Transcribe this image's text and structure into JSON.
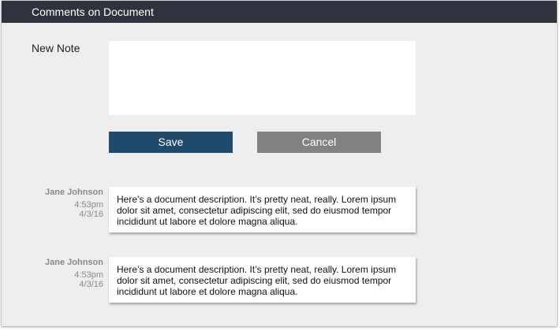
{
  "header": {
    "title": "Comments on Document"
  },
  "new_note": {
    "label": "New Note",
    "value": "",
    "placeholder": ""
  },
  "actions": {
    "save_label": "Save",
    "cancel_label": "Cancel"
  },
  "comments": [
    {
      "author": "Jane Johnson",
      "time": "4:53pm",
      "date": "4/3/16",
      "text": "Here’s a document description. It’s pretty neat, really. Lorem ipsum dolor sit amet, consectetur adipiscing elit, sed do eiusmod tempor incididunt ut labore et dolore magna aliqua."
    },
    {
      "author": "Jane Johnson",
      "time": "4:53pm",
      "date": "4/3/16",
      "text": "Here’s a document description. It’s pretty neat, really. Lorem ipsum dolor sit amet, consectetur adipiscing elit, sed do eiusmod tempor incididunt ut labore et dolore magna aliqua."
    }
  ],
  "colors": {
    "titlebar": "#2f333d",
    "background": "#eeeeee",
    "save_button": "#1f4a6b",
    "cancel_button": "#828282"
  }
}
